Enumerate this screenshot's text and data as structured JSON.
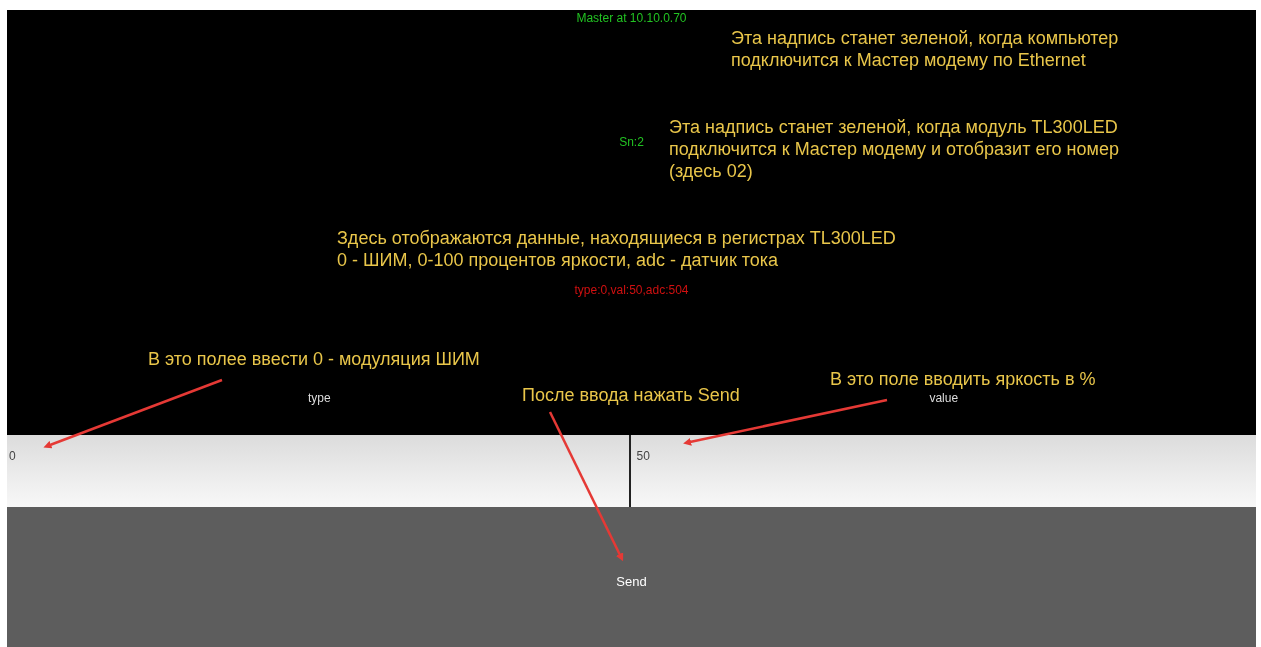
{
  "app": {
    "master_status": "Master at 10.10.0.70",
    "module_status": "Sn:2",
    "register_data": "type:0,val:50,adc:504",
    "fields": [
      {
        "label": "type",
        "value": "0"
      },
      {
        "label": "value",
        "value": "50"
      }
    ],
    "send_button": "Send"
  },
  "annotations": [
    {
      "lines": [
        "Эта надпись станет зеленой, когда компьютер",
        "подключится к Мастер модему по Ethernet"
      ],
      "arrow": false
    },
    {
      "lines": [
        "Эта надпись станет зеленой, когда модуль TL300LED",
        "подключится к Мастер модему и отобразит его номер",
        "(здесь 02)"
      ],
      "arrow": false
    },
    {
      "lines": [
        "Здесь отображаются данные, находящиеся в регистрах TL300LED",
        "0 - ШИМ, 0-100 процентов яркости, adc - датчик тока"
      ],
      "arrow": false
    },
    {
      "lines": [
        "В это полее ввести 0 - модуляция ШИМ"
      ],
      "arrow": true
    },
    {
      "lines": [
        "После ввода нажать Send"
      ],
      "arrow": true
    },
    {
      "lines": [
        "В это поле вводить яркость в %"
      ],
      "arrow": true
    }
  ]
}
